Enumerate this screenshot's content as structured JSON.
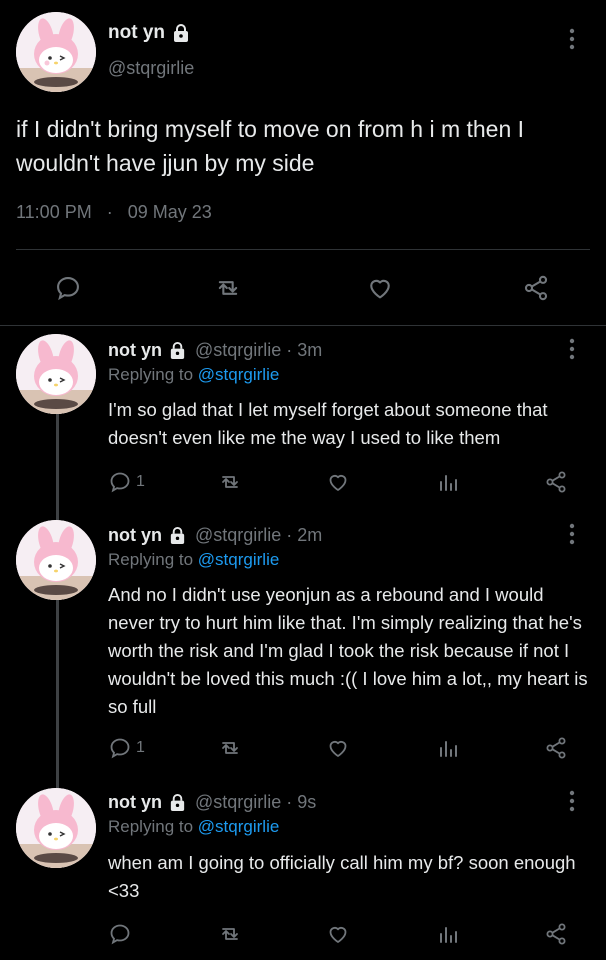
{
  "main_tweet": {
    "name": "not yn",
    "handle": "@stqrgirlie",
    "text": "if I didn't bring myself to move on from h i m then I wouldn't have jjun by my side",
    "time": "11:00 PM",
    "separator": "·",
    "date": "09 May 23"
  },
  "replies": [
    {
      "name": "not yn",
      "handle": "@stqrgirlie",
      "age": "· 3m",
      "replying_label": "Replying to",
      "replying_handle": "@stqrgirlie",
      "text": "I'm so glad that I let myself forget about someone that doesn't even like me the way I used to like them",
      "reply_count": "1"
    },
    {
      "name": "not yn",
      "handle": "@stqrgirlie",
      "age": "· 2m",
      "replying_label": "Replying to",
      "replying_handle": "@stqrgirlie",
      "text": "And no I didn't use yeonjun as a rebound and I would never try to hurt him like that. I'm simply realizing that he's worth the risk and I'm glad I took the risk because if not I wouldn't be loved this much :(( I love him a lot,, my heart is so full",
      "reply_count": "1"
    },
    {
      "name": "not yn",
      "handle": "@stqrgirlie",
      "age": "· 9s",
      "replying_label": "Replying to",
      "replying_handle": "@stqrgirlie",
      "text": "when am I going to officially call him my bf? soon enough <33",
      "reply_count": ""
    }
  ],
  "icons": {
    "reply": "speech-bubble-icon",
    "retweet": "retweet-icon",
    "like": "heart-icon",
    "analytics": "bar-chart-icon",
    "share": "share-icon",
    "more": "more-vertical-icon",
    "lock": "lock-icon",
    "avatar": "my-melody-avatar"
  },
  "colors": {
    "background": "#000000",
    "text": "#e7e9ea",
    "muted": "#71767b",
    "link": "#1d9bf0",
    "divider": "#2f3336"
  }
}
